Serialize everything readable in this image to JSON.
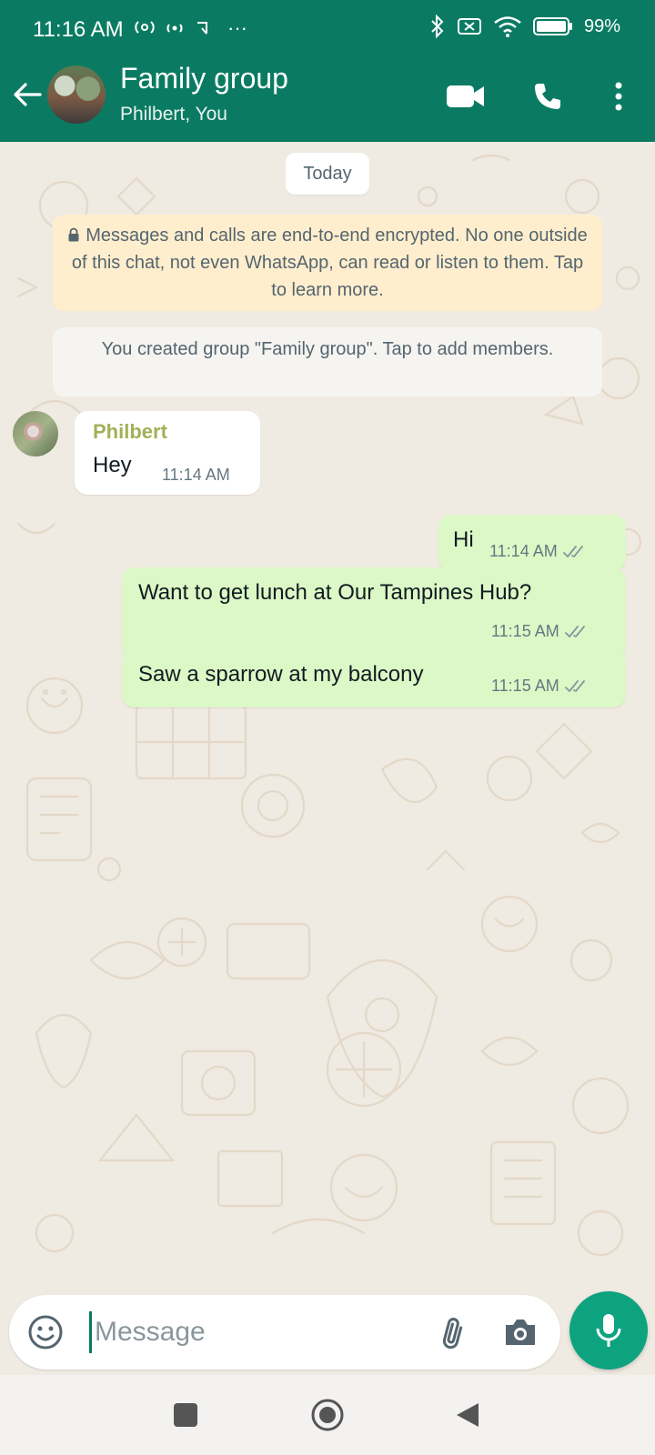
{
  "status_bar": {
    "time": "11:16 AM",
    "battery": "99%",
    "more_dots": "···"
  },
  "header": {
    "title": "Family group",
    "subtitle": "Philbert, You"
  },
  "chat": {
    "date_chip": "Today",
    "encryption_notice": "Messages and calls are end-to-end encrypted. No one outside of this chat, not even WhatsApp, can read or listen to them. Tap to learn more.",
    "system_message": "You created group \"Family group\". Tap to add members.",
    "messages": [
      {
        "direction": "incoming",
        "sender": "Philbert",
        "text": "Hey",
        "time": "11:14 AM"
      },
      {
        "direction": "outgoing",
        "text": "Hi",
        "time": "11:14 AM",
        "status": "read"
      },
      {
        "direction": "outgoing",
        "text": "Want to get lunch at Our Tampines Hub?",
        "time": "11:15 AM",
        "status": "read"
      },
      {
        "direction": "outgoing",
        "text": "Saw a sparrow at my balcony",
        "time": "11:15 AM",
        "status": "read"
      }
    ]
  },
  "composer": {
    "placeholder": "Message"
  },
  "colors": {
    "header_green": "#0a7b62",
    "outgoing_bubble": "#dcf8c6",
    "incoming_bubble": "#ffffff",
    "encryption_bg": "#ffeecd",
    "sender_name": "#a3b058",
    "mic_button": "#0da37f",
    "wallpaper": "#efeae2"
  },
  "icons": [
    "back-arrow-icon",
    "video-call-icon",
    "voice-call-icon",
    "more-vert-icon",
    "lock-icon",
    "double-check-icon",
    "emoji-icon",
    "paperclip-icon",
    "camera-icon",
    "mic-icon",
    "nav-recents-icon",
    "nav-home-icon",
    "nav-back-icon"
  ]
}
